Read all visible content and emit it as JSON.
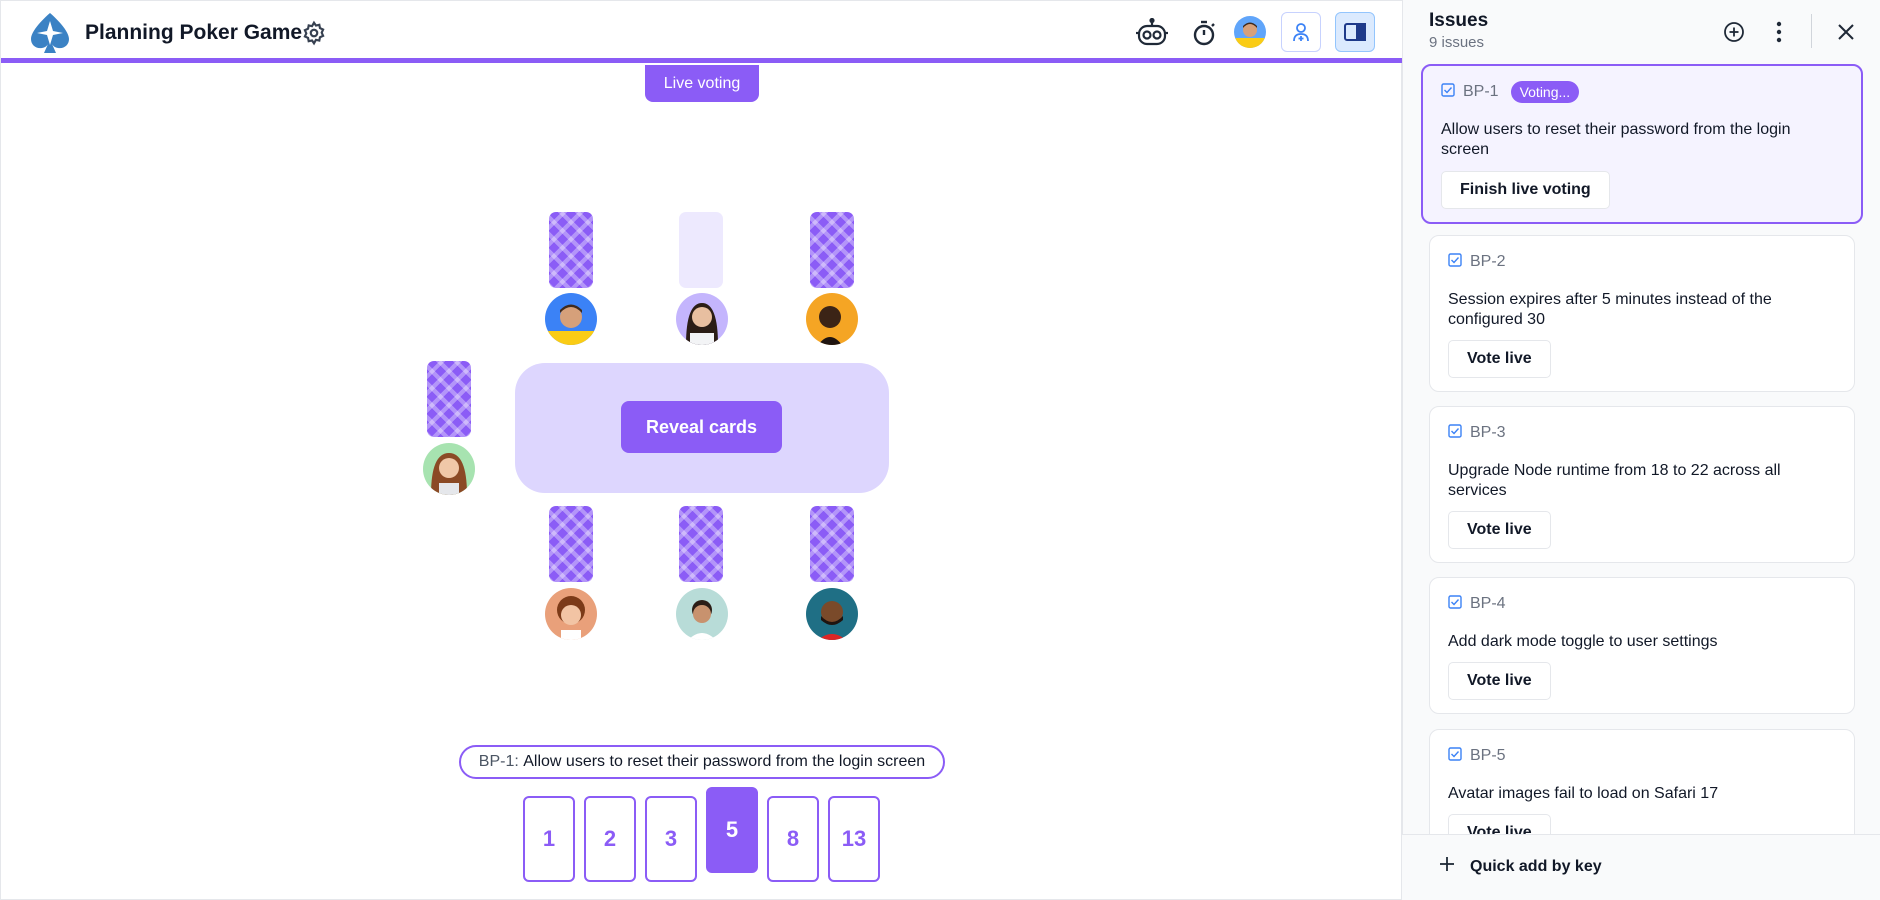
{
  "app": {
    "title": "Planning Poker Game"
  },
  "colors": {
    "accent": "#8b5cf6",
    "accent_light": "#ddd6fe",
    "card_empty": "#ede9fe"
  },
  "toolbar": {
    "icons": [
      "robot-icon",
      "timer-icon",
      "avatar",
      "invite-icon",
      "panel-toggle-icon"
    ]
  },
  "game": {
    "live_label": "Live voting",
    "reveal_label": "Reveal cards",
    "current_issue": {
      "key": "BP-1:",
      "title": "Allow users to reset their password from the login screen"
    },
    "players": [
      {
        "id": "top-1",
        "card": "back",
        "avatar_color": "#3b82f6"
      },
      {
        "id": "top-2",
        "card": "empty",
        "avatar_color": "#c084fc"
      },
      {
        "id": "top-3",
        "card": "back",
        "avatar_color": "#f59e0b"
      },
      {
        "id": "left-1",
        "card": "back",
        "avatar_color": "#86efac"
      },
      {
        "id": "bottom-1",
        "card": "back",
        "avatar_color": "#f97316"
      },
      {
        "id": "bottom-2",
        "card": "back",
        "avatar_color": "#a7f3d0"
      },
      {
        "id": "bottom-3",
        "card": "back",
        "avatar_color": "#0e7490"
      }
    ],
    "deck": [
      "1",
      "2",
      "3",
      "5",
      "8",
      "13"
    ],
    "selected_card": "5"
  },
  "sidebar": {
    "title": "Issues",
    "count": "9 issues",
    "quick_add": "Quick add by key",
    "issues": [
      {
        "key": "BP-1",
        "status": "Voting...",
        "title": "Allow users to reset their password from the login screen",
        "action": "Finish live voting",
        "active": true
      },
      {
        "key": "BP-2",
        "title": "Session expires after 5 minutes instead of the configured 30",
        "action": "Vote live"
      },
      {
        "key": "BP-3",
        "title": "Upgrade Node runtime from 18 to 22 across all services",
        "action": "Vote live"
      },
      {
        "key": "BP-4",
        "title": "Add dark mode toggle to user settings",
        "action": "Vote live"
      },
      {
        "key": "BP-5",
        "title": "Avatar images fail to load on Safari 17",
        "action": "Vote live"
      }
    ]
  }
}
